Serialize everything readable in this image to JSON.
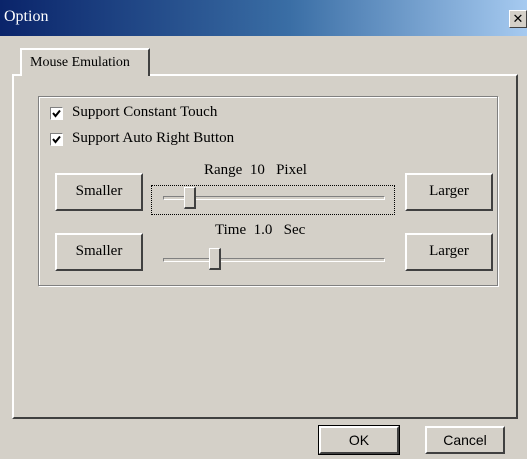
{
  "window": {
    "title": "Option",
    "close_icon": "close-icon"
  },
  "tabs": [
    {
      "label": "Mouse Emulation",
      "active": true
    }
  ],
  "options": {
    "constant_touch": {
      "label": "Support Constant Touch",
      "checked": true
    },
    "auto_right_button": {
      "label": "Support Auto Right Button",
      "checked": true
    }
  },
  "range": {
    "label": "Range  10   Pixel",
    "value": 10,
    "unit": "Pixel",
    "position_fraction": 0.1,
    "smaller_label": "Smaller",
    "larger_label": "Larger"
  },
  "time": {
    "label": "Time  1.0   Sec",
    "value": 1.0,
    "unit": "Sec",
    "position_fraction": 0.22,
    "smaller_label": "Smaller",
    "larger_label": "Larger"
  },
  "footer": {
    "ok_label": "OK",
    "cancel_label": "Cancel"
  },
  "colors": {
    "face": "#d4d0c8",
    "title_start": "#0a246a",
    "title_end": "#a6caf0"
  }
}
